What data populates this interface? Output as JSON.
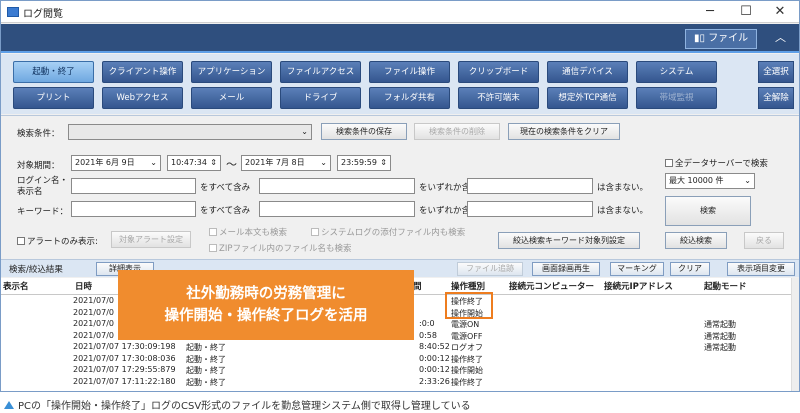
{
  "window": {
    "title": "ログ閲覧",
    "minimize": "─",
    "maximize": "☐",
    "close": "✕"
  },
  "banner": {
    "file_label": "ファイル",
    "collapse": "︿"
  },
  "categories": {
    "row1": [
      "起動・終了",
      "クライアント操作",
      "アプリケーション",
      "ファイルアクセス",
      "ファイル操作",
      "クリップボード",
      "通信デバイス",
      "システム"
    ],
    "row2": [
      "プリント",
      "Webアクセス",
      "メール",
      "ドライブ",
      "フォルダ共有",
      "不許可端末",
      "想定外TCP通信",
      "帯域監視"
    ],
    "select_all": "全選択",
    "deselect_all": "全解除"
  },
  "search": {
    "condition_label": "検索条件：",
    "condition_value": "",
    "save_btn": "検索条件の保存",
    "delete_btn": "検索条件の削除",
    "clear_btn": "現在の検索条件をクリア",
    "period_label": "対象期間：",
    "date_from": "2021年 6月 9日",
    "time_from": "10:47:34",
    "tilde": "〜",
    "date_to": "2021年 7月 8日",
    "time_to": "23:59:59",
    "login_label_1": "ログイン名・",
    "login_label_2": "表示名",
    "keyword_label": "キーワード：",
    "all_include": "をすべて含み",
    "any_include": "をいずれか含む。",
    "not_include": "は含まない。",
    "all_servers": "全データサーバーで検索",
    "max_count": "最大 10000 件",
    "search_btn": "検索",
    "narrow_btn": "絞込検索",
    "back_btn": "戻る",
    "alert_only": "アラートのみ表示:",
    "alert_setting": "対象アラート設定",
    "mail_body": "メール本文も検索",
    "syslog_attach": "システムログの添付ファイル内も検索",
    "zip_names": "ZIPファイル内のファイル名も検索",
    "narrow_keyword": "絞込検索キーワード対象列設定"
  },
  "results": {
    "title": "検索/絞込結果",
    "detail_btn": "詳細表示",
    "file_trace": "ファイル追跡",
    "screen_play": "画面録画再生",
    "marking": "マーキング",
    "clear": "クリア",
    "col_change": "表示項目変更"
  },
  "grid": {
    "headers": [
      "表示名",
      "日時",
      "間",
      "操作種別",
      "接続元コンピューター",
      "接続元IPアドレス",
      "起動モード"
    ],
    "rows": [
      {
        "date": "2021/07/0",
        "cat": "",
        "dur": "",
        "op": "操作終了",
        "mode": ""
      },
      {
        "date": "2021/07/0",
        "cat": "",
        "dur": "",
        "op": "操作開始",
        "mode": ""
      },
      {
        "date": "2021/07/0",
        "cat": "",
        "dur": ":0:0",
        "op": "電源ON",
        "mode": "通常起動"
      },
      {
        "date": "2021/07/0",
        "cat": "",
        "dur": "0:58",
        "op": "電源OFF",
        "mode": "通常起動"
      },
      {
        "date": "2021/07/07 17:30:09:198",
        "cat": "起動・終了",
        "dur": "8:40:52",
        "op": "ログオフ",
        "mode": "通常起動"
      },
      {
        "date": "2021/07/07 17:30:08:036",
        "cat": "起動・終了",
        "dur": "0:00:12",
        "op": "操作終了",
        "mode": ""
      },
      {
        "date": "2021/07/07 17:29:55:879",
        "cat": "起動・終了",
        "dur": "0:00:12",
        "op": "操作開始",
        "mode": ""
      },
      {
        "date": "2021/07/07 17:11:22:180",
        "cat": "起動・終了",
        "dur": "2:33:26",
        "op": "操作終了",
        "mode": ""
      }
    ]
  },
  "callout": {
    "line1": "社外勤務時の労務管理に",
    "line2": "操作開始・操作終了ログを活用"
  },
  "caption": "PCの「操作開始・操作終了」ログのCSV形式のファイルを勤怠管理システム側で取得し管理している",
  "colors": {
    "accent": "#f08c2e",
    "banner": "#2f4f7e",
    "category": "#34568f"
  }
}
